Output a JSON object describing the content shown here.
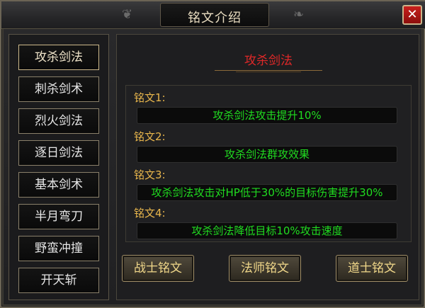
{
  "window": {
    "title": "铭文介绍",
    "close_symbol": "✕"
  },
  "sidebar": {
    "items": [
      {
        "label": "攻杀剑法",
        "active": true
      },
      {
        "label": "刺杀剑术",
        "active": false
      },
      {
        "label": "烈火剑法",
        "active": false
      },
      {
        "label": "逐日剑法",
        "active": false
      },
      {
        "label": "基本剑术",
        "active": false
      },
      {
        "label": "半月弯刀",
        "active": false
      },
      {
        "label": "野蛮冲撞",
        "active": false
      },
      {
        "label": "开天斩",
        "active": false
      }
    ]
  },
  "detail": {
    "title": "攻杀剑法",
    "runes": [
      {
        "label": "铭文1:",
        "value": "攻杀剑法攻击提升10%"
      },
      {
        "label": "铭文2:",
        "value": "攻杀剑法群攻效果"
      },
      {
        "label": "铭文3:",
        "value": "攻杀剑法攻击对HP低于30%的目标伤害提升30%"
      },
      {
        "label": "铭文4:",
        "value": "攻杀剑法降低目标10%攻击速度"
      }
    ]
  },
  "buttons": {
    "warrior": "战士铭文",
    "mage": "法师铭文",
    "taoist": "道士铭文"
  },
  "colors": {
    "title_red": "#e02828",
    "label_gold": "#e8b64c",
    "value_green": "#20dc20",
    "button_text": "#f1d88a"
  }
}
